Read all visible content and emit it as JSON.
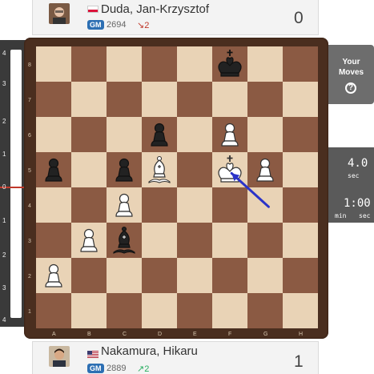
{
  "top_player": {
    "flag_color": "#dc143c",
    "name": "Duda, Jan-Krzysztof",
    "title": "GM",
    "rating": "2694",
    "rating_change": "↘2",
    "rating_change_color": "#c0392b",
    "score": "0"
  },
  "bottom_player": {
    "name": "Nakamura, Hikaru",
    "title": "GM",
    "rating": "2889",
    "rating_change": "↗2",
    "rating_change_color": "#27ae60",
    "score": "1"
  },
  "eval_bar": {
    "ticks_top": [
      "4",
      "3",
      "2",
      "1"
    ],
    "zero": "0",
    "ticks_bottom": [
      "1",
      "2",
      "3",
      "4"
    ]
  },
  "board": {
    "light_color": "#e9d3b6",
    "dark_color": "#8b5a43",
    "ranks": [
      "8",
      "7",
      "6",
      "5",
      "4",
      "3",
      "2",
      "1"
    ],
    "files": [
      "A",
      "B",
      "C",
      "D",
      "E",
      "F",
      "G",
      "H"
    ],
    "pieces": [
      {
        "square": "f8",
        "piece": "king",
        "color": "black"
      },
      {
        "square": "d6",
        "piece": "pawn",
        "color": "black"
      },
      {
        "square": "f6",
        "piece": "pawn",
        "color": "white"
      },
      {
        "square": "a5",
        "piece": "pawn",
        "color": "black"
      },
      {
        "square": "c5",
        "piece": "pawn",
        "color": "black"
      },
      {
        "square": "d5",
        "piece": "bishop",
        "color": "white"
      },
      {
        "square": "f5",
        "piece": "king",
        "color": "white"
      },
      {
        "square": "g5",
        "piece": "pawn",
        "color": "white"
      },
      {
        "square": "c4",
        "piece": "pawn",
        "color": "white"
      },
      {
        "square": "b3",
        "piece": "pawn",
        "color": "white"
      },
      {
        "square": "c3",
        "piece": "bishop",
        "color": "black"
      },
      {
        "square": "a2",
        "piece": "pawn",
        "color": "white"
      }
    ],
    "arrow": {
      "from": "g4",
      "to": "f5",
      "color": "#2b33c8"
    }
  },
  "side_panel": {
    "your_moves_line1": "Your",
    "your_moves_line2": "Moves",
    "help_icon": "?"
  },
  "clock": {
    "value": "4.0",
    "unit": "sec",
    "timer": "1:00",
    "min_label": "min",
    "sec_label": "sec"
  }
}
